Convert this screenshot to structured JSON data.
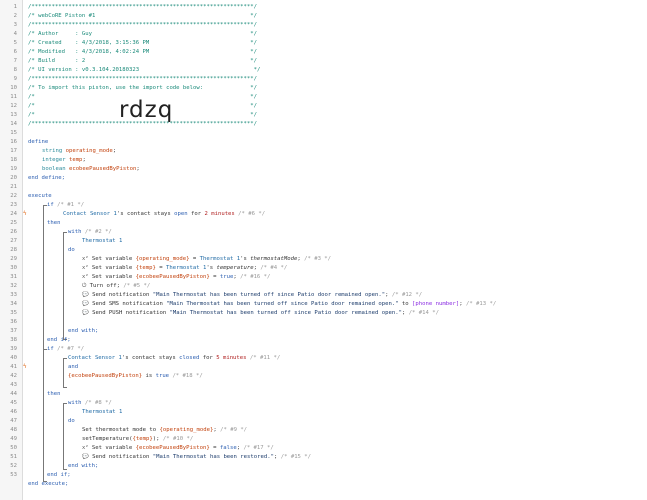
{
  "header": {
    "stars": "/******************************************************************/",
    "title": "/* webCoRE Piston #1                                              */",
    "author": "/* Author     : Guy                                               */",
    "created": "/* Created    : 4/3/2018, 3:15:36 PM                              */",
    "modified": "/* Modified   : 4/3/2018, 4:02:24 PM                              */",
    "build": "/* Build      : 2                                                 */",
    "ui": "/* UI version : v0.3.104.20180323                                  */",
    "import": "/* To import this piston, use the import code below:              */",
    "blank": "/*                                                                */",
    "code": "rdzq"
  },
  "lines": {
    "l16": "define",
    "l17_type": "string",
    "l17_var": "operating_mode",
    "l18_type": "integer",
    "l18_var": "temp",
    "l19_type": "boolean",
    "l19_var": "ecobeePausedByPiston",
    "l20": "end define;",
    "l22": "execute",
    "l23_kw": "if",
    "l23_c": "/* #1 */",
    "l24_dev": "Contact Sensor 1",
    "l24_a": "'s contact stays ",
    "l24_val": "open",
    "l24_b": " for ",
    "l24_num": "2 minutes",
    "l24_c": "/* #6 */",
    "l25": "then",
    "l26_kw": "with",
    "l26_c": "/* #2 */",
    "l27": "Thermostat 1",
    "l28": "do",
    "l29_a": "Set variable ",
    "l29_v": "{operating_mode}",
    "l29_b": " = ",
    "l29_d": "Thermostat 1",
    "l29_e": "'s ",
    "l29_f": "thermostatMode",
    "l29_g": ";",
    "l29_c": "/* #3 */",
    "l30_a": "Set variable ",
    "l30_v": "{temp}",
    "l30_b": " = ",
    "l30_d": "Thermostat 1",
    "l30_e": "'s ",
    "l30_f": "temperature",
    "l30_g": ";",
    "l30_c": "/* #4 */",
    "l31_a": "Set variable ",
    "l31_v": "{ecobeePausedByPiston}",
    "l31_b": " = ",
    "l31_t": "true",
    "l31_g": ";",
    "l31_c": "/* #16 */",
    "l32_a": "Turn off;",
    "l32_c": "/* #5 */",
    "l33_a": "Send notification ",
    "l33_s": "\"Main Thermostat has been turned off since Patio door remained open.\"",
    "l33_g": ";",
    "l33_c": "/* #12 */",
    "l34_a": "Send SMS notification ",
    "l34_s": "\"Main Thermostat has been turned off since Patio door remained open.\"",
    "l34_b": " to ",
    "l34_p": "[phone number]",
    "l34_g": ";",
    "l34_c": "/* #13 */",
    "l35_a": "Send PUSH notification ",
    "l35_s": "\"Main Thermostat has been turned off since Patio door remained open.\"",
    "l35_g": ";",
    "l35_c": "/* #14 */",
    "l36": "end with;",
    "l37": "end if;",
    "l38_kw": "if",
    "l38_c": "/* #7 */",
    "l39_dev": "Contact Sensor 1",
    "l39_a": "'s contact stays ",
    "l39_val": "closed",
    "l39_b": " for ",
    "l39_num": "5 minutes",
    "l39_c": "/* #11 */",
    "l40": "and",
    "l41_v": "{ecobeePausedByPiston}",
    "l41_a": " is ",
    "l41_t": "true",
    "l41_c": "/* #18 */",
    "l42": "then",
    "l43_kw": "with",
    "l43_c": "/* #8 */",
    "l44": "Thermostat 1",
    "l45": "do",
    "l46_a": "Set thermostat mode to ",
    "l46_v": "{operating_mode}",
    "l46_g": ";",
    "l46_c": "/* #9 */",
    "l47_a": "setTemperature(",
    "l47_v": "{temp}",
    "l47_b": ");",
    "l47_c": "/* #10 */",
    "l48_a": "Set variable ",
    "l48_v": "{ecobeePausedByPiston}",
    "l48_b": " = ",
    "l48_t": "false",
    "l48_g": ";",
    "l48_c": "/* #17 */",
    "l49_a": "Send notification ",
    "l49_s": "\"Main Thermostat has been restored.\"",
    "l49_g": ";",
    "l49_c": "/* #15 */",
    "l50": "end with;",
    "l51": "end if;",
    "l52": "end execute;"
  },
  "colors": {
    "comment": "#1a8a7a",
    "keyword": "#2a5db0",
    "variable": "#c2410c",
    "device": "#1f6aa5",
    "trigger": "#e06a1a"
  },
  "icons": [
    "lightning-bolt-icon",
    "power-icon",
    "chat-bubble-icon",
    "variable-icon"
  ]
}
